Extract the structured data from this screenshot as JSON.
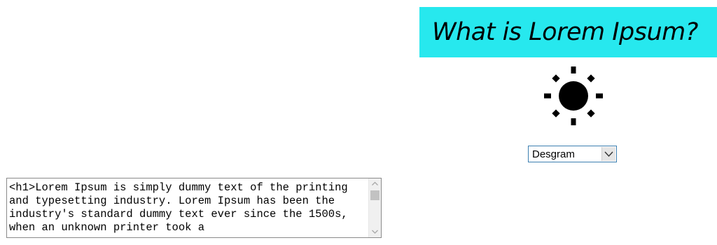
{
  "heading": {
    "text": "What is Lorem Ipsum?",
    "background": "#27e8ee"
  },
  "sun_icon": {
    "name": "sun-icon"
  },
  "dropdown": {
    "selected": "Desgram"
  },
  "code_box": {
    "text": "<h1>Lorem Ipsum is simply dummy text of the printing and typesetting industry. Lorem Ipsum has been the industry's standard dummy text ever since the 1500s, when an unknown printer took a"
  }
}
